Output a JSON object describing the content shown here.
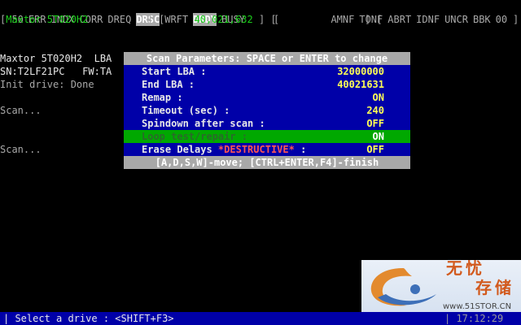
{
  "status_flags": [
    {
      "label": "50",
      "active": false
    },
    {
      "label": "ERR",
      "active": false
    },
    {
      "label": "INDX",
      "active": false
    },
    {
      "label": "CORR",
      "active": false
    },
    {
      "label": "DREQ",
      "active": false
    },
    {
      "label": "DRSC",
      "active": true
    },
    {
      "label": "WRFT",
      "active": false
    },
    {
      "label": "DRDY",
      "active": true
    },
    {
      "label": "BUSY",
      "active": false
    }
  ],
  "error_flags": [
    "AMNF",
    "TONF",
    "ABRT",
    "IDNF",
    "UNCR",
    "BBK",
    "00"
  ],
  "drive_bar": {
    "model": "Maxtor 5T020H2",
    "sep1": "] [",
    "lba": "40,021,632",
    "sep2": "] [",
    "sep3": "] ["
  },
  "console": {
    "line1": "Maxtor 5T020H2  LBA",
    "line2": "SN:T2LF21PC   FW:TA",
    "line3": "Init drive: Done",
    "line4": "Scan...",
    "line5": "Scan..."
  },
  "dialog": {
    "title": "Scan Parameters: SPACE or ENTER to change",
    "rows": [
      {
        "label": "Start LBA :",
        "value": "32000000"
      },
      {
        "label": "End LBA :",
        "value": "40021631"
      },
      {
        "label": "Remap :",
        "value": "ON"
      },
      {
        "label": "Timeout (sec) :",
        "value": "240"
      },
      {
        "label": "Spindown after scan :",
        "value": "OFF"
      },
      {
        "label": "Loop test/repair :",
        "value": "ON"
      },
      {
        "label_a": "Erase Delays ",
        "label_b": "*DESTRUCTIVE*",
        "label_c": " :",
        "value": "OFF"
      }
    ],
    "hint": "[A,D,S,W]-move; [CTRL+ENTER,F4]-finish"
  },
  "bottom_bar": {
    "prompt": "| Select a drive : <SHIFT+F3>",
    "clock": "| 17:12:29"
  },
  "watermark": {
    "cn_top": "无忧",
    "cn_bottom": "存储",
    "url": "www.51STOR.CN"
  },
  "colors": {
    "dialog_bg": "#0000a8",
    "selected_row": "#00a800",
    "value_text": "#ffff55",
    "destructive": "#ff5555"
  }
}
